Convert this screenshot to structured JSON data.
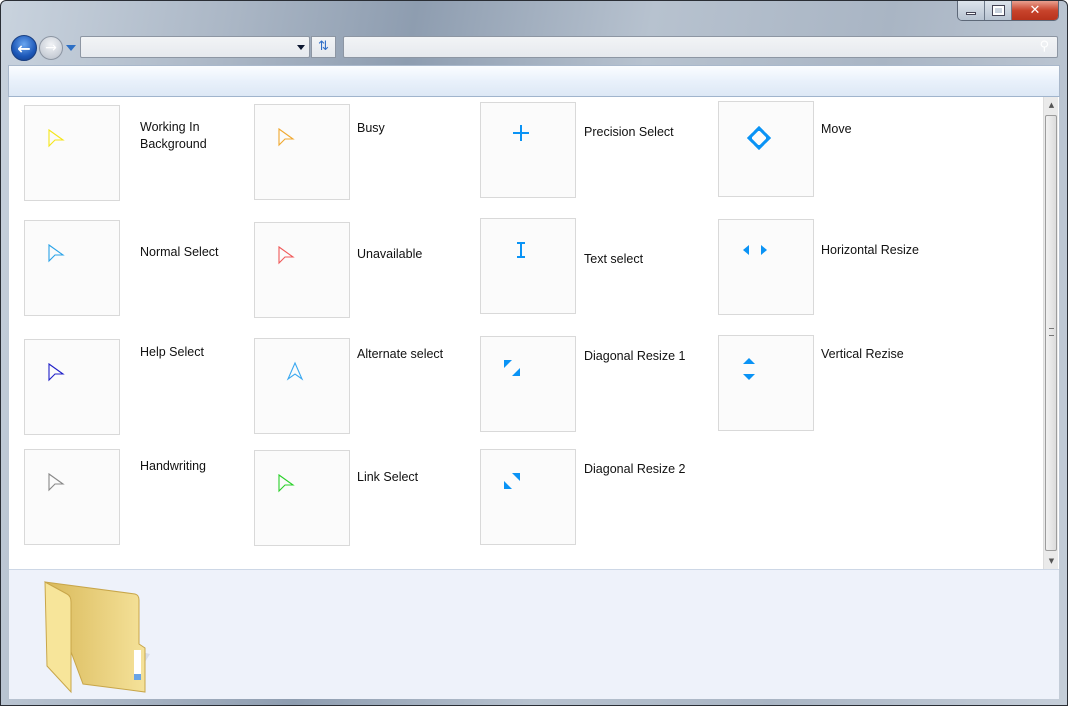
{
  "window": {
    "controls": {
      "minimize": "—",
      "maximize": "□",
      "close": "✕"
    }
  },
  "address": {
    "value": ""
  },
  "search": {
    "placeholder": ""
  },
  "accent": "#0a93f5",
  "items": [
    {
      "label": "Working In Background",
      "icon": "arrow-cursor",
      "color": "#f5e61a"
    },
    {
      "label": "Busy",
      "icon": "arrow-cursor",
      "color": "#f0a830"
    },
    {
      "label": "Precision Select",
      "icon": "crosshair",
      "color": "#0a93f5"
    },
    {
      "label": "Move",
      "icon": "move",
      "color": "#0a93f5"
    },
    {
      "label": "Normal Select",
      "icon": "arrow-cursor",
      "color": "#2aa3e8"
    },
    {
      "label": "Unavailable",
      "icon": "arrow-cursor",
      "color": "#f05a5a"
    },
    {
      "label": "Text select",
      "icon": "ibeam",
      "color": "#0a93f5"
    },
    {
      "label": "Horizontal Resize",
      "icon": "horizontal-resize",
      "color": "#0a93f5"
    },
    {
      "label": "Help Select",
      "icon": "arrow-cursor",
      "color": "#2020c8"
    },
    {
      "label": "Alternate select",
      "icon": "up-arrow-cursor",
      "color": "#3aa8f0"
    },
    {
      "label": "Diagonal Resize 1",
      "icon": "diagonal-resize-1",
      "color": "#0a93f5"
    },
    {
      "label": "Vertical Rezise",
      "icon": "vertical-resize",
      "color": "#0a93f5"
    },
    {
      "label": "Handwriting",
      "icon": "arrow-cursor",
      "color": "#888888"
    },
    {
      "label": "Link Select",
      "icon": "arrow-cursor",
      "color": "#2ad02a"
    },
    {
      "label": "Diagonal Resize 2",
      "icon": "diagonal-resize-2",
      "color": "#0a93f5"
    }
  ]
}
